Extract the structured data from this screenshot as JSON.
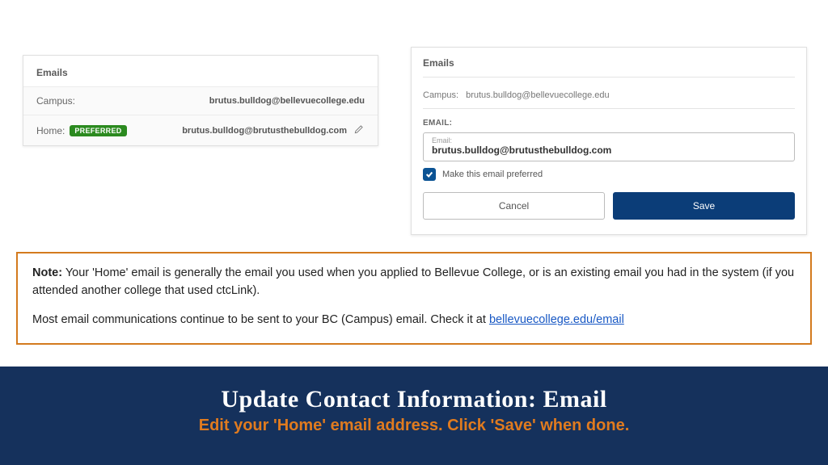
{
  "leftPanel": {
    "header": "Emails",
    "rows": [
      {
        "label": "Campus:",
        "value": "brutus.bulldog@bellevuecollege.edu",
        "preferred": false,
        "editable": false
      },
      {
        "label": "Home:",
        "value": "brutus.bulldog@brutusthebulldog.com",
        "preferred": true,
        "editable": true
      }
    ],
    "preferredBadge": "PREFERRED"
  },
  "rightPanel": {
    "header": "Emails",
    "campusLabel": "Campus:",
    "campusValue": "brutus.bulldog@bellevuecollege.edu",
    "sectionLabel": "EMAIL:",
    "fieldFloat": "Email:",
    "fieldValue": "brutus.bulldog@brutusthebulldog.com",
    "checkboxLabel": "Make this email preferred",
    "checkboxChecked": true,
    "cancel": "Cancel",
    "save": "Save"
  },
  "note": {
    "boldLabel": "Note:",
    "line1": " Your 'Home' email is generally the email you used when you applied to Bellevue College, or is an existing email you had in the system (if you attended another college that used ctcLink).",
    "line2a": "Most email communications continue to be sent to your BC (Campus) email. Check it at ",
    "link": "bellevuecollege.edu/email"
  },
  "footer": {
    "title": "Update Contact Information: Email",
    "subtitle": "Edit your 'Home' email address. Click 'Save' when done."
  }
}
